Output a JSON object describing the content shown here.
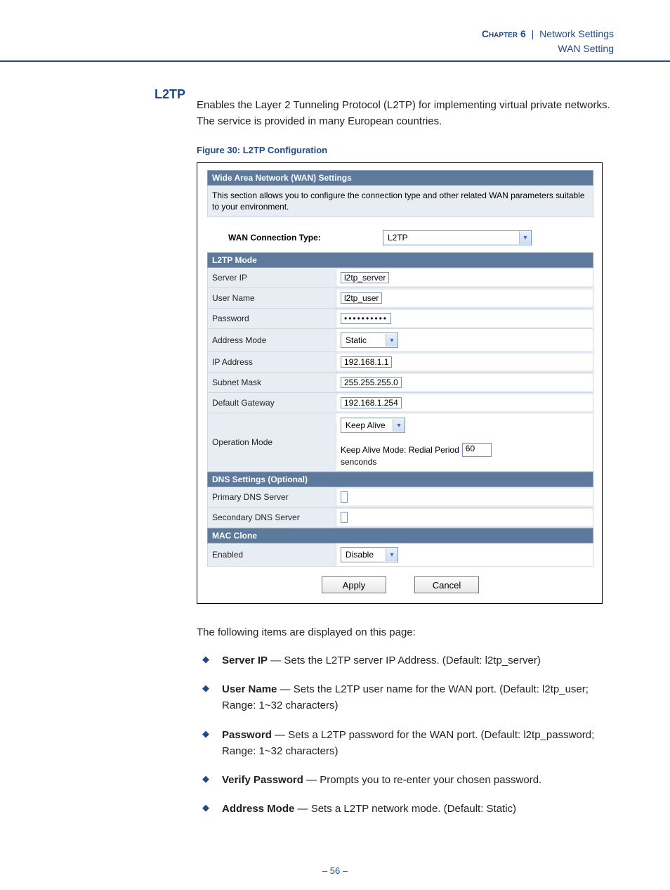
{
  "header": {
    "chapter": "Chapter 6",
    "separator": "|",
    "title": "Network Settings",
    "subtitle": "WAN Setting"
  },
  "sidehead": "L2TP",
  "intro": "Enables the Layer 2 Tunneling Protocol (L2TP) for implementing virtual private networks. The service is provided in many European countries.",
  "figcap": "Figure 30:  L2TP Configuration",
  "panel": {
    "head": "Wide Area Network (WAN) Settings",
    "desc": "This section allows you to configure the connection type and other related WAN parameters suitable to your environment."
  },
  "wct": {
    "label": "WAN Connection Type:",
    "value": "L2TP"
  },
  "sections": {
    "l2tp": "L2TP Mode",
    "dns": "DNS Settings (Optional)",
    "mac": "MAC Clone"
  },
  "fields": {
    "server_ip": {
      "label": "Server IP",
      "value": "l2tp_server"
    },
    "user_name": {
      "label": "User Name",
      "value": "l2tp_user"
    },
    "password": {
      "label": "Password",
      "value": "••••••••••"
    },
    "addr_mode": {
      "label": "Address Mode",
      "value": "Static"
    },
    "ip": {
      "label": "IP Address",
      "value": "192.168.1.1"
    },
    "mask": {
      "label": "Subnet Mask",
      "value": "255.255.255.0"
    },
    "gw": {
      "label": "Default Gateway",
      "value": "192.168.1.254"
    },
    "opmode": {
      "label": "Operation Mode",
      "value": "Keep Alive",
      "prefix": "Keep Alive Mode: Redial Period",
      "period": "60",
      "suffix": "senconds"
    },
    "pdns": {
      "label": "Primary DNS Server",
      "value": ""
    },
    "sdns": {
      "label": "Secondary DNS Server",
      "value": ""
    },
    "mac_en": {
      "label": "Enabled",
      "value": "Disable"
    }
  },
  "buttons": {
    "apply": "Apply",
    "cancel": "Cancel"
  },
  "after_intro": "The following items are displayed on this page:",
  "bullets": [
    {
      "term": "Server IP",
      "text": " — Sets the L2TP server IP Address. (Default: l2tp_server)"
    },
    {
      "term": "User Name",
      "text": " — Sets the L2TP user name for the WAN port. (Default: l2tp_user; Range: 1~32 characters)"
    },
    {
      "term": "Password",
      "text": " — Sets a L2TP password for the WAN port. (Default: l2tp_password; Range: 1~32 characters)"
    },
    {
      "term": "Verify Password",
      "text": " — Prompts you to re-enter your chosen password."
    },
    {
      "term": "Address Mode",
      "text": " — Sets a L2TP network mode. (Default: Static)"
    }
  ],
  "pagenum": "–  56  –"
}
